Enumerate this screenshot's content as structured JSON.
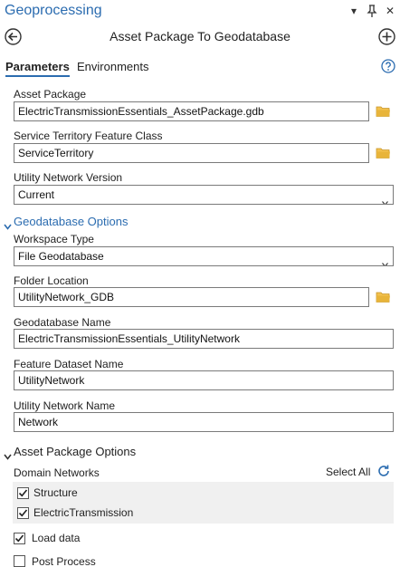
{
  "pane": {
    "title": "Geoprocessing",
    "controls": {
      "menu": "▾",
      "pin": "📌",
      "close": "✕"
    }
  },
  "tool": {
    "name": "Asset Package To Geodatabase"
  },
  "tabs": {
    "parameters": "Parameters",
    "environments": "Environments"
  },
  "params": {
    "asset_package": {
      "label": "Asset Package",
      "value": "ElectricTransmissionEssentials_AssetPackage.gdb"
    },
    "service_territory": {
      "label": "Service Territory Feature Class",
      "value": "ServiceTerritory"
    },
    "un_version": {
      "label": "Utility Network Version",
      "value": "Current"
    }
  },
  "gdb_options": {
    "header": "Geodatabase Options",
    "workspace_type": {
      "label": "Workspace Type",
      "value": "File Geodatabase"
    },
    "folder_location": {
      "label": "Folder Location",
      "value": "UtilityNetwork_GDB"
    },
    "gdb_name": {
      "label": "Geodatabase Name",
      "value": "ElectricTransmissionEssentials_UtilityNetwork"
    },
    "feature_dataset": {
      "label": "Feature Dataset Name",
      "value": "UtilityNetwork"
    },
    "un_name": {
      "label": "Utility Network Name",
      "value": "Network"
    }
  },
  "ap_options": {
    "header": "Asset Package Options",
    "domain_networks_label": "Domain Networks",
    "select_all": "Select All",
    "domain_networks": [
      {
        "label": "Structure",
        "checked": true
      },
      {
        "label": "ElectricTransmission",
        "checked": true
      }
    ],
    "load_data": {
      "label": "Load data",
      "checked": true
    },
    "post_process": {
      "label": "Post Process",
      "checked": false
    }
  },
  "colors": {
    "accent": "#2b6cb0",
    "folder": "#e8b43a"
  }
}
